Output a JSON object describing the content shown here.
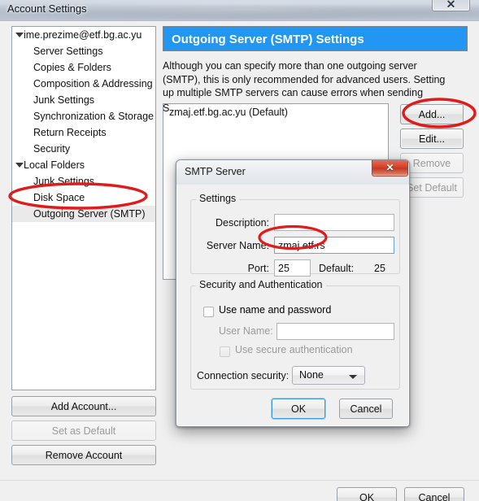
{
  "window": {
    "title": "Account Settings",
    "close_glyph": "✕"
  },
  "sidebar": {
    "items": [
      {
        "label": "ime.prezime@etf.bg.ac.yu",
        "level": 0,
        "twisty": true,
        "selected": false
      },
      {
        "label": "Server Settings",
        "level": 1,
        "twisty": false,
        "selected": false
      },
      {
        "label": "Copies & Folders",
        "level": 1,
        "twisty": false,
        "selected": false
      },
      {
        "label": "Composition & Addressing",
        "level": 1,
        "twisty": false,
        "selected": false
      },
      {
        "label": "Junk Settings",
        "level": 1,
        "twisty": false,
        "selected": false
      },
      {
        "label": "Synchronization & Storage",
        "level": 1,
        "twisty": false,
        "selected": false
      },
      {
        "label": "Return Receipts",
        "level": 1,
        "twisty": false,
        "selected": false
      },
      {
        "label": "Security",
        "level": 1,
        "twisty": false,
        "selected": false
      },
      {
        "label": "Local Folders",
        "level": 0,
        "twisty": true,
        "selected": false
      },
      {
        "label": "Junk Settings",
        "level": 1,
        "twisty": false,
        "selected": false
      },
      {
        "label": "Disk Space",
        "level": 1,
        "twisty": false,
        "selected": false
      },
      {
        "label": "Outgoing Server (SMTP)",
        "level": 1,
        "twisty": false,
        "selected": true
      }
    ],
    "buttons": {
      "add_account": "Add Account...",
      "set_as_default": "Set as Default",
      "remove_account": "Remove Account"
    }
  },
  "pane": {
    "header": "Outgoing Server (SMTP) Settings",
    "description": "Although you can specify more than one outgoing server (SMTP), this is only recommended for advanced users. Setting up multiple SMTP servers can cause errors when sending messages.",
    "description_sliver": "S",
    "server_list": [
      "zmaj.etf.bg.ac.yu (Default)"
    ],
    "buttons": {
      "add": "Add...",
      "edit": "Edit...",
      "remove": "Remove",
      "set_default": "Set Default"
    }
  },
  "main_buttons": {
    "ok": "OK",
    "cancel": "Cancel"
  },
  "dialog": {
    "title": "SMTP Server",
    "close_glyph": "✕",
    "settings_group": {
      "legend": "Settings",
      "description_label": "Description:",
      "description_value": "",
      "server_name_label": "Server Name:",
      "server_name_value": "zmaj.etf.rs",
      "port_label": "Port:",
      "port_value": "25",
      "default_label": "Default:",
      "default_value": "25"
    },
    "security_group": {
      "legend": "Security and Authentication",
      "use_name_password_label": "Use name and password",
      "use_name_password_checked": false,
      "user_name_label": "User Name:",
      "user_name_value": "",
      "secure_auth_label": "Use secure authentication",
      "secure_auth_checked": false,
      "connection_security_label": "Connection security:",
      "connection_security_value": "None"
    },
    "buttons": {
      "ok": "OK",
      "cancel": "Cancel"
    }
  },
  "annotations": {
    "color": "#e01b1b",
    "ellipses": [
      {
        "name": "annot-outgoing-server-smtp"
      },
      {
        "name": "annot-edit-button"
      },
      {
        "name": "annot-server-name-value"
      }
    ]
  }
}
